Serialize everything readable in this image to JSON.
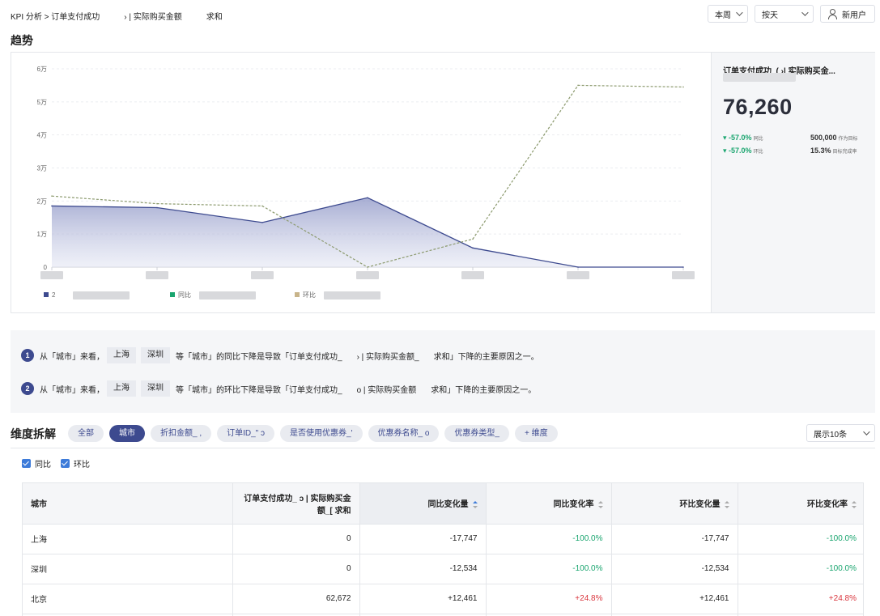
{
  "breadcrumb": {
    "part1": "KPI 分析 > 订单支付成功",
    "part2": "› | 实际购买金额",
    "part3": "求和"
  },
  "controls": {
    "period": "本周",
    "granularity": "按天",
    "user_filter": "新用户"
  },
  "trend": {
    "title": "趋势"
  },
  "chart_data": {
    "type": "line",
    "y_ticks": [
      "0",
      "1万",
      "2万",
      "3万",
      "4万",
      "5万",
      "6万"
    ],
    "ylim": [
      0,
      60000
    ],
    "x": [
      0,
      1,
      2,
      3,
      4,
      5,
      6
    ],
    "series": [
      {
        "values": [
          18500,
          18000,
          13500,
          21000,
          5800,
          0,
          0
        ],
        "color": "#3d4a8f"
      },
      {
        "values": [
          21500,
          19200,
          18500,
          0,
          8500,
          55000,
          54500
        ],
        "color": "#8c9a6e"
      }
    ],
    "legend": [
      {
        "label": "2",
        "color": "#3d4a8f"
      },
      {
        "label": "同比",
        "color": "#1aa56f"
      },
      {
        "label": "环比",
        "color": "#c8b48a"
      }
    ]
  },
  "kpi": {
    "title": "订单支付成功_(     ›| 实际购买金...",
    "value": "76,260",
    "yoy": {
      "change": "-57.0%",
      "label": "同比"
    },
    "mom": {
      "change": "-57.0%",
      "label": "环比"
    },
    "target": {
      "value": "500,000",
      "label": "作为目标"
    },
    "completion": {
      "value": "15.3%",
      "label": "目标完成率"
    }
  },
  "insights": [
    {
      "num": "1",
      "prefix": "从「城市」来看，",
      "tags": [
        "上海",
        "深圳"
      ],
      "mid": "等「城市」的同比下降是导致「订单支付成功_",
      "mid2": "› | 实际购买金额_",
      "suffix": "求和」下降的主要原因之一。"
    },
    {
      "num": "2",
      "prefix": "从「城市」来看，",
      "tags": [
        "上海",
        "深圳"
      ],
      "mid": "等「城市」的环比下降是导致「订单支付成功_",
      "mid2": "o | 实际购买金额",
      "suffix": "求和」下降的主要原因之一。"
    }
  ],
  "dimension": {
    "title": "维度拆解",
    "chips": [
      "全部",
      "城市",
      "折扣金额_     ,",
      "订单ID_\"     ɔ",
      "是否使用优惠券_'",
      "优惠券名称_     o",
      "优惠券类型_",
      "+ 维度"
    ],
    "active_chip": "城市",
    "show_select": "展示10条",
    "checkboxes": [
      "同比",
      "环比"
    ]
  },
  "table": {
    "headers": [
      "城市",
      "订单支付成功_     ɔ | 实际购买金额_[     求和",
      "同比变化量",
      "同比变化率",
      "环比变化量",
      "环比变化率"
    ],
    "rows": [
      [
        "上海",
        "0",
        "-17,747",
        "-100.0%",
        "-17,747",
        "-100.0%"
      ],
      [
        "深圳",
        "0",
        "-12,534",
        "-100.0%",
        "-12,534",
        "-100.0%"
      ],
      [
        "北京",
        "62,672",
        "+12,461",
        "+24.8%",
        "+12,461",
        "+24.8%"
      ]
    ]
  }
}
